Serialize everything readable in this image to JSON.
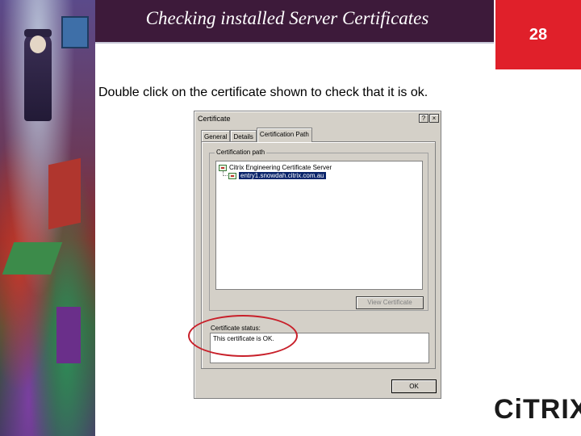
{
  "slide": {
    "title": "Checking installed Server Certificates",
    "page_number": "28",
    "instruction": "Double click on the certificate shown to check that it is ok.",
    "logo": "CiTRIX"
  },
  "dialog": {
    "title": "Certificate",
    "help_label": "?",
    "close_label": "×",
    "tabs": [
      {
        "label": "General"
      },
      {
        "label": "Details"
      },
      {
        "label": "Certification Path"
      }
    ],
    "active_tab": "Certification Path",
    "path_group_label": "Certification path",
    "tree": {
      "root": "Citrix Engineering Certificate Server",
      "child": "entry1.snowdah.citrix.com.au"
    },
    "view_certificate_label": "View Certificate",
    "status_label": "Certificate status:",
    "status_text": "This certificate is OK.",
    "ok_label": "OK"
  },
  "colors": {
    "title_bar": "#3d1a3a",
    "page_number_bg": "#e0202a",
    "highlight": "#c8202a",
    "selection": "#0a246a"
  }
}
